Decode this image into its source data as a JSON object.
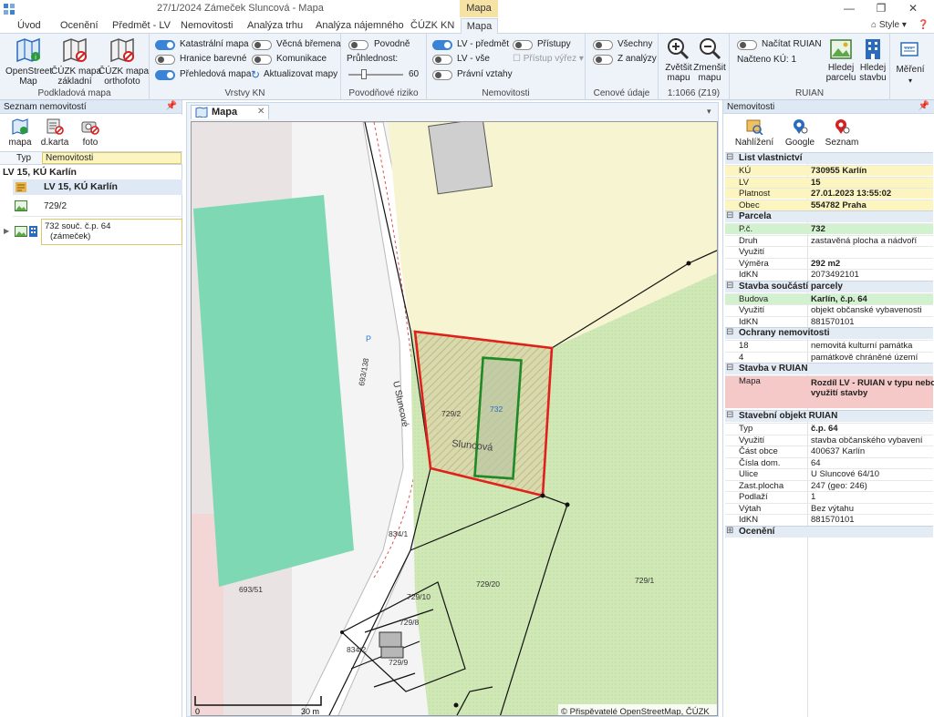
{
  "window": {
    "title": "27/1/2024  Zámeček Sluncová - Mapa"
  },
  "menu": {
    "tabs": [
      "Úvod",
      "Ocenění",
      "Předmět - LV",
      "Nemovitosti",
      "Analýza trhu",
      "Analýza nájemného",
      "ČÚZK KN"
    ],
    "context_tab": "Mapa",
    "active_tab": "Mapa",
    "style_label": "Style"
  },
  "ribbon": {
    "podklad": {
      "label": "Podkladová mapa",
      "btn1": "OpenStreet\nMap",
      "btn2": "ČÚZK mapa\nzákladní",
      "btn3": "ČÚZK mapa\northofoto"
    },
    "vrstvy": {
      "label": "Vrstvy KN",
      "t1": "Katastrální mapa",
      "t2": "Hranice barevné",
      "t3": "Přehledová mapa",
      "t4": "Věcná břemena",
      "t5": "Komunikace",
      "t6": "Aktualizovat mapy"
    },
    "povod": {
      "label": "Povodňové riziko",
      "t1": "Povodně",
      "pruh": "Průhlednost:",
      "val": "60"
    },
    "nem": {
      "label": "Nemovitosti",
      "t1": "LV - předmět",
      "t2": "LV - vše",
      "t3": "Právní vztahy",
      "t4": "Přístupy",
      "t5": "Přístup výřez"
    },
    "cen": {
      "label": "Cenové údaje",
      "t1": "Všechny",
      "t2": "Z analýzy"
    },
    "zoom": {
      "label": "1:1066 (Z19)",
      "in": "Zvětšit\nmapu",
      "out": "Zmenšit\nmapu"
    },
    "ruian": {
      "label": "RUIAN",
      "t1": "Načítat RUIAN",
      "nacteno": "Načteno KÚ:  1",
      "b1": "Hledej\nparcelu",
      "b2": "Hledej\nstavbu"
    },
    "mereni": "Měření"
  },
  "left": {
    "title": "Seznam nemovitostí",
    "btns": [
      "mapa",
      "d.karta",
      "foto"
    ],
    "col1": "Typ",
    "col2": "Nemovitosti",
    "group": "LV 15, KÚ Karlín",
    "lv": "LV 15,  KÚ Karlín",
    "item1": "729/2",
    "item2a": "732  souč. č.p. 64",
    "item2b": "(zámeček)"
  },
  "map": {
    "tab": "Mapa",
    "street": "U Sluncové",
    "area": "Sluncová",
    "parcels": [
      "729/2",
      "732",
      "729/1",
      "729/10",
      "729/20",
      "729/8",
      "729/9",
      "834/1",
      "834/2",
      "693/138",
      "693/51"
    ],
    "scale0": "0",
    "scale30": "30 m",
    "copyright": "© Přispěvatelé OpenStreetMap, ČÚZK",
    "p": "P"
  },
  "right": {
    "title": "Nemovitosti",
    "btns": [
      "Nahlížení",
      "Google",
      "Seznam"
    ],
    "sections": {
      "lv": {
        "title": "List vlastnictví",
        "rows": [
          [
            "KÚ",
            "730955  Karlín"
          ],
          [
            "LV",
            "15"
          ],
          [
            "Platnost",
            "27.01.2023 13:55:02"
          ],
          [
            "Obec",
            "554782  Praha"
          ]
        ]
      },
      "parcela": {
        "title": "Parcela",
        "rows": [
          [
            "P.č.",
            "732"
          ],
          [
            "Druh",
            "zastavěná plocha a nádvoří"
          ],
          [
            "Využití",
            ""
          ],
          [
            "Výměra",
            "292  m2"
          ],
          [
            "IdKN",
            "2073492101"
          ]
        ]
      },
      "stavba": {
        "title": "Stavba součástí parcely",
        "rows": [
          [
            "Budova",
            "Karlín, č.p. 64"
          ],
          [
            "Využití",
            "objekt občanské vybavenosti"
          ],
          [
            "IdKN",
            "881570101"
          ]
        ]
      },
      "ochrany": {
        "title": "Ochrany nemovitosti",
        "rows": [
          [
            "18",
            "nemovitá kulturní památka"
          ],
          [
            "4",
            "památkově chráněné území"
          ]
        ]
      },
      "ruian": {
        "title": "Stavba v RUIAN",
        "k": "Mapa",
        "v1": "Rozdíl LV - RUIAN v typu nebo",
        "v2": "využití stavby"
      },
      "sobj": {
        "title": "Stavební objekt RUIAN",
        "rows": [
          [
            "Typ",
            "č.p. 64"
          ],
          [
            "Využití",
            "stavba občanského vybavení"
          ],
          [
            "Část obce",
            "400637  Karlín"
          ],
          [
            "Čísla dom.",
            "64"
          ],
          [
            "Ulice",
            "U Sluncové 64/10"
          ],
          [
            "Zast.plocha",
            "247  (geo: 246)"
          ],
          [
            "Podlaží",
            "1"
          ],
          [
            "Výtah",
            "Bez výtahu"
          ],
          [
            "IdKN",
            "881570101"
          ]
        ]
      },
      "oceneni": {
        "title": "Ocenění"
      }
    }
  },
  "colors": {
    "ribbon": "#eef3fa",
    "accent": "#3b83d6",
    "parcelRed": "#e0201a",
    "buildingGreen": "#1e8a25"
  }
}
